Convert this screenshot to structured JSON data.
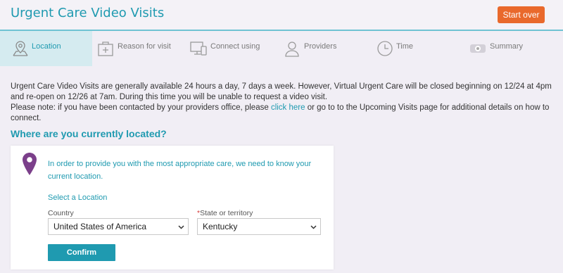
{
  "header": {
    "title": "Urgent Care Video Visits",
    "start_over_label": "Start over"
  },
  "steps": [
    {
      "label": "Location",
      "icon": "map-pin-icon",
      "active": true
    },
    {
      "label": "Reason for visit",
      "icon": "medical-kit-icon",
      "active": false
    },
    {
      "label": "Connect using",
      "icon": "devices-icon",
      "active": false
    },
    {
      "label": "Providers",
      "icon": "person-icon",
      "active": false
    },
    {
      "label": "Time",
      "icon": "clock-icon",
      "active": false
    },
    {
      "label": "Summary",
      "icon": "eye-icon",
      "active": false
    }
  ],
  "notice": {
    "availability_text": "Urgent Care Video Visits are generally available 24 hours a day, 7 days a week. However, Virtual Urgent Care will be closed beginning on 12/24 at 4pm and re-open on 12/26 at 7am. During this time you will be unable to request a video visit.",
    "note_prefix": "Please note: if you have been contacted by your providers office, please ",
    "click_here_label": "click here",
    "note_suffix": " or go to to the Upcoming Visits page for additional details on how to connect."
  },
  "question": "Where are you currently located?",
  "location_card": {
    "message": "In order to provide you with the most appropriate care, we need to know your current location.",
    "select_location_label": "Select a Location",
    "country_label": "Country",
    "country_value": "United States of America",
    "state_required_mark": "*",
    "state_label": "State or territory",
    "state_value": "Kentucky",
    "confirm_label": "Confirm"
  },
  "colors": {
    "accent": "#1f9ab0",
    "start_over": "#e9692c",
    "pin": "#7b3f8a",
    "background": "#f1eef5"
  }
}
